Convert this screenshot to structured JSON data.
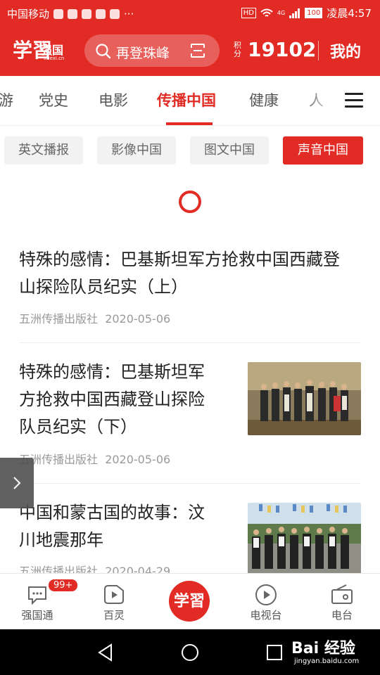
{
  "status_bar": {
    "carrier": "中国移动",
    "network": "4G",
    "battery": "100",
    "time": "凌晨4:57",
    "hd": "HD",
    "more": "···"
  },
  "header": {
    "logo_text": "学習",
    "logo_sub": "强国",
    "logo_url": "xuexi.cn",
    "search_placeholder": "再登珠峰",
    "score_label": "积分",
    "score_value": "19102",
    "mine_label": "我的"
  },
  "tabs": [
    {
      "label": "游"
    },
    {
      "label": "党史"
    },
    {
      "label": "电影"
    },
    {
      "label": "传播中国",
      "active": true
    },
    {
      "label": "健康"
    },
    {
      "label": "人"
    }
  ],
  "sub_tabs": [
    {
      "label": "英文播报"
    },
    {
      "label": "影像中国"
    },
    {
      "label": "图文中国"
    },
    {
      "label": "声音中国",
      "active": true
    }
  ],
  "articles": [
    {
      "title_lines": [
        "特殊的感情：巴基斯坦军方抢救中国西藏登",
        "山探险队员纪实（上）"
      ],
      "source": "五洲传播出版社",
      "date": "2020-05-06"
    },
    {
      "title_lines": [
        "特殊的感情：巴基斯坦军",
        "方抢救中国西藏登山探险",
        "队员纪实（下）"
      ],
      "source": "五洲传播出版社",
      "date": "2020-05-06",
      "thumb": "group-photo-indoor"
    },
    {
      "title_lines": [
        "中国和蒙古国的故事：汶",
        "川地震那年"
      ],
      "source": "五洲传播出版社",
      "date": "2020-04-29",
      "thumb": "group-photo-outdoor-flags"
    }
  ],
  "bottom_nav": [
    {
      "label": "强国通",
      "icon": "chat-bubble-icon",
      "badge": "99+"
    },
    {
      "label": "百灵",
      "icon": "play-square-icon"
    },
    {
      "label": "学習",
      "icon": "xuexi-logo-icon"
    },
    {
      "label": "电视台",
      "icon": "play-circle-icon"
    },
    {
      "label": "电台",
      "icon": "radio-icon"
    }
  ],
  "watermark": {
    "text": "Bai 经验",
    "url": "jingyan.baidu.com"
  },
  "colors": {
    "brand": "#e12b24",
    "text": "#222222",
    "meta": "#999999",
    "chip_bg": "#f2f2f2"
  }
}
